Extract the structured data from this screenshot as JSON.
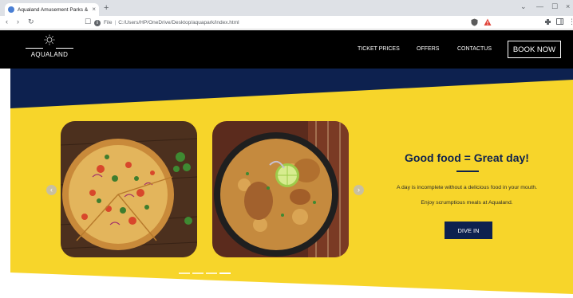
{
  "browser": {
    "tab_title": "Aqualand Amusement Parks & Re",
    "tab_close": "×",
    "new_tab": "+",
    "back": "‹",
    "forward": "›",
    "reload": "↻",
    "bookmark": "☐",
    "url_scheme": "File",
    "url_separator": "|",
    "url": "C:/Users/HP/OneDrive/Desktop/aquapark/index.html",
    "window_controls": [
      "⌄",
      "—",
      "☐",
      "×"
    ]
  },
  "header": {
    "logo_text": "AQUALAND",
    "nav": [
      "TICKET PRICES",
      "OFFERS",
      "CONTACTUS"
    ],
    "book_label": "BOOK NOW"
  },
  "hero": {
    "title": "Good food = Great day!",
    "line1": "A day is incomplete without a delicious food in your mouth.",
    "line2": "Enjoy scrumptious meals at Aqualand.",
    "cta_label": "DIVE IN",
    "prev_arrow": "‹",
    "next_arrow": "›",
    "slide_count": 4,
    "active_slide": 4
  },
  "colors": {
    "navy": "#0d214f",
    "yellow": "#f7d52a",
    "header_black": "#000000"
  },
  "icons": {
    "shield": "shield-icon",
    "warning": "warning-icon",
    "puzzle": "extensions-icon",
    "sun": "sun-logo-icon"
  }
}
